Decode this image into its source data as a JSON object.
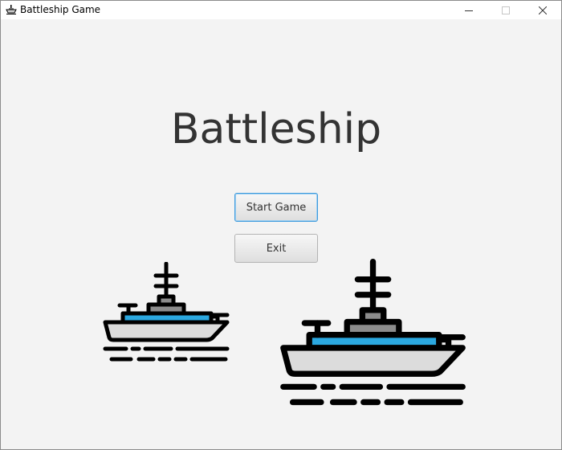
{
  "window": {
    "title": "Battleship Game",
    "controls": {
      "minimize": "—",
      "maximize": "☐",
      "close": "✕"
    }
  },
  "main": {
    "heading": "Battleship",
    "start_button": "Start Game",
    "exit_button": "Exit"
  },
  "colors": {
    "background": "#f3f3f3",
    "ship_hull": "#dcdcdc",
    "ship_deck_stripe": "#2ba8e0",
    "ship_tower": "#8c8c8c",
    "outline": "#000000",
    "focus_border": "#3e9bdd"
  },
  "icons": [
    "app-ship-icon",
    "small-battleship-icon",
    "large-battleship-icon"
  ]
}
